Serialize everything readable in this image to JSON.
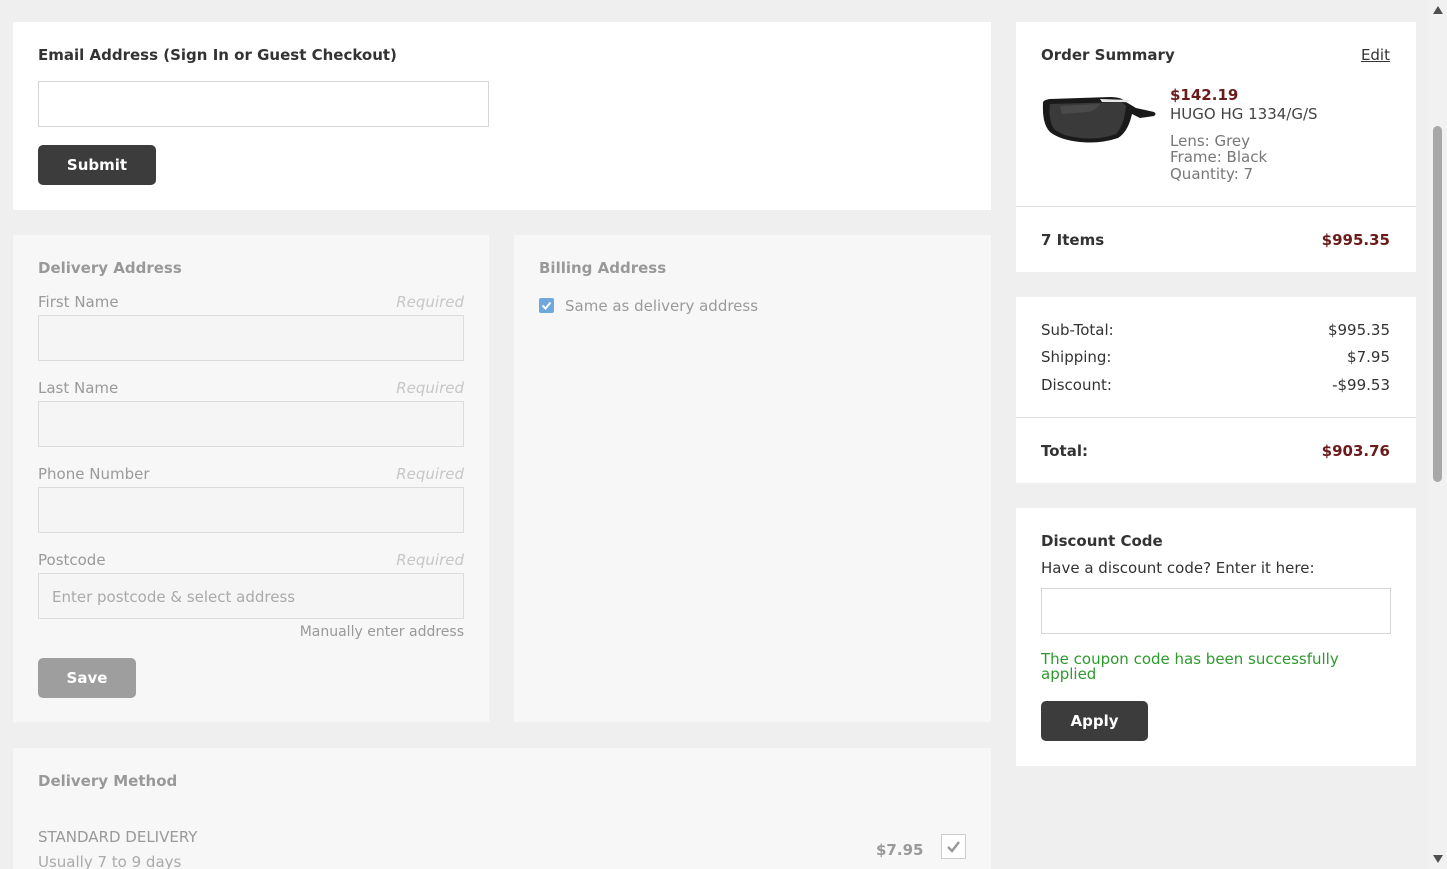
{
  "email": {
    "heading": "Email Address",
    "subheading": "(Sign In or Guest Checkout)",
    "input_value": "",
    "submit_label": "Submit"
  },
  "delivery_address": {
    "heading": "Delivery Address",
    "first_name_label": "First Name",
    "last_name_label": "Last Name",
    "phone_label": "Phone Number",
    "postcode_label": "Postcode",
    "required_text": "Required",
    "postcode_placeholder": "Enter postcode & select address",
    "manual_link": "Manually enter address",
    "save_label": "Save"
  },
  "billing_address": {
    "heading": "Billing Address",
    "same_as_delivery_label": "Same as delivery address",
    "same_as_delivery_checked": true
  },
  "delivery_method": {
    "heading": "Delivery Method",
    "option_name": "STANDARD DELIVERY",
    "option_desc": "Usually 7 to 9 days",
    "option_price": "$7.95"
  },
  "order_summary": {
    "heading": "Order Summary",
    "edit_label": "Edit",
    "item": {
      "price": "$142.19",
      "name": "HUGO HG 1334/G/S",
      "lens": "Lens: Grey",
      "frame": "Frame: Black",
      "quantity": "Quantity: 7"
    },
    "items_count": "7 Items",
    "items_total": "$995.35"
  },
  "totals": {
    "subtotal_label": "Sub-Total:",
    "subtotal_value": "$995.35",
    "shipping_label": "Shipping:",
    "shipping_value": "$7.95",
    "discount_label": "Discount:",
    "discount_value": "-$99.53",
    "total_label": "Total:",
    "total_value": "$903.76"
  },
  "discount_code": {
    "heading": "Discount Code",
    "prompt": "Have a discount code? Enter it here:",
    "input_value": "",
    "success_message": "The coupon code has been successfully applied",
    "apply_label": "Apply"
  },
  "colors": {
    "price": "#6b1a1a",
    "success": "#2e9a2e",
    "button": "#3c3c3c",
    "checkbox": "#4a90d9"
  }
}
